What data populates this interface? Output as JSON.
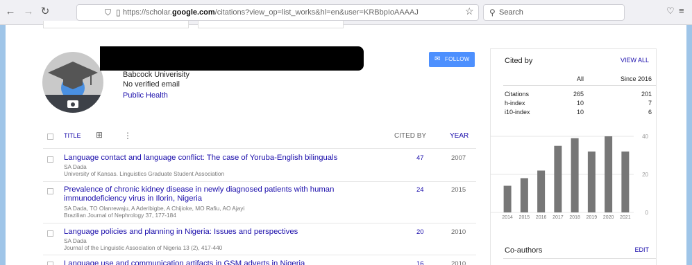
{
  "browser": {
    "url_prefix": "https://scholar.",
    "url_domain": "google.com",
    "url_suffix": "/citations?view_op=list_works&hl=en&user=KRBbpIoAAAAJ",
    "search_placeholder": "Search"
  },
  "profile": {
    "affiliation": "Babcock Univerisity",
    "email": "No verified email",
    "interest": "Public Health",
    "follow_label": "FOLLOW"
  },
  "table": {
    "title_header": "TITLE",
    "cited_header": "CITED BY",
    "year_header": "YEAR",
    "rows": [
      {
        "title": "Language contact and language conflict: The case of Yoruba-English bilinguals",
        "authors": "SA Dada",
        "venue": "University of Kansas. Linguistics Graduate Student Association",
        "cited": "47",
        "year": "2007"
      },
      {
        "title": "Prevalence of chronic kidney disease in newly diagnosed patients with human immunodeficiency virus in Ilorin, Nigeria",
        "authors": "SA Dada, TO Olanrewaju, A Aderibigbe, A Chijioke, MO Rafiu, AO Ajayi",
        "venue": "Brazilian Journal of Nephrology 37, 177-184",
        "cited": "24",
        "year": "2015"
      },
      {
        "title": "Language policies and planning in Nigeria: Issues and perspectives",
        "authors": "SA Dada",
        "venue": "Journal of the Linguistic Association of Nigeria 13 (2), 417-440",
        "cited": "20",
        "year": "2010"
      },
      {
        "title": "Language use and communication artifacts in GSM adverts in Nigeria",
        "cited": "16",
        "year": "2010"
      }
    ]
  },
  "cited_by": {
    "heading": "Cited by",
    "view_all": "VIEW ALL",
    "col_all": "All",
    "col_since": "Since 2016",
    "stats": [
      {
        "label": "Citations",
        "all": "265",
        "since": "201"
      },
      {
        "label": "h-index",
        "all": "10",
        "since": "7"
      },
      {
        "label": "i10-index",
        "all": "10",
        "since": "6"
      }
    ]
  },
  "coauthors": {
    "heading": "Co-authors",
    "edit": "EDIT"
  },
  "colors": {
    "link": "#1a0dab",
    "follow_button": "#4d90fe",
    "bar": "#777777",
    "frame": "#9fc5e8"
  },
  "chart_data": {
    "type": "bar",
    "categories": [
      "2014",
      "2015",
      "2016",
      "2017",
      "2018",
      "2019",
      "2020",
      "2021"
    ],
    "values": [
      14,
      18,
      22,
      35,
      39,
      32,
      40,
      32
    ],
    "ylim": [
      0,
      40
    ],
    "yticks": [
      "40",
      "20",
      "0"
    ],
    "grid": true
  }
}
